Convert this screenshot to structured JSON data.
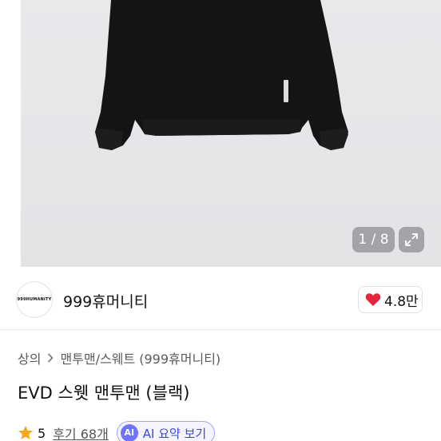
{
  "gallery": {
    "counter": "1 / 8",
    "current_index": 1,
    "total": 8,
    "expand_icon": "expand-arrows-icon"
  },
  "shop": {
    "avatar_text": "999HUMANITY",
    "name": "999휴머니티",
    "rating": "4.8만",
    "rating_icon": "heart-icon",
    "rating_icon_color": "#e5243b"
  },
  "breadcrumb": {
    "items": [
      "상의",
      "맨투맨/스웨트 (999휴머니티)"
    ]
  },
  "product": {
    "title": "EVD 스웻 맨투맨 (블랙)",
    "star_icon_color": "#f5a623",
    "rating_value": "5",
    "review_link": "후기 68개",
    "ai_badge": "AI",
    "ai_summary_label": "AI 요약 보기",
    "ai_accent": "#6f73ff"
  }
}
